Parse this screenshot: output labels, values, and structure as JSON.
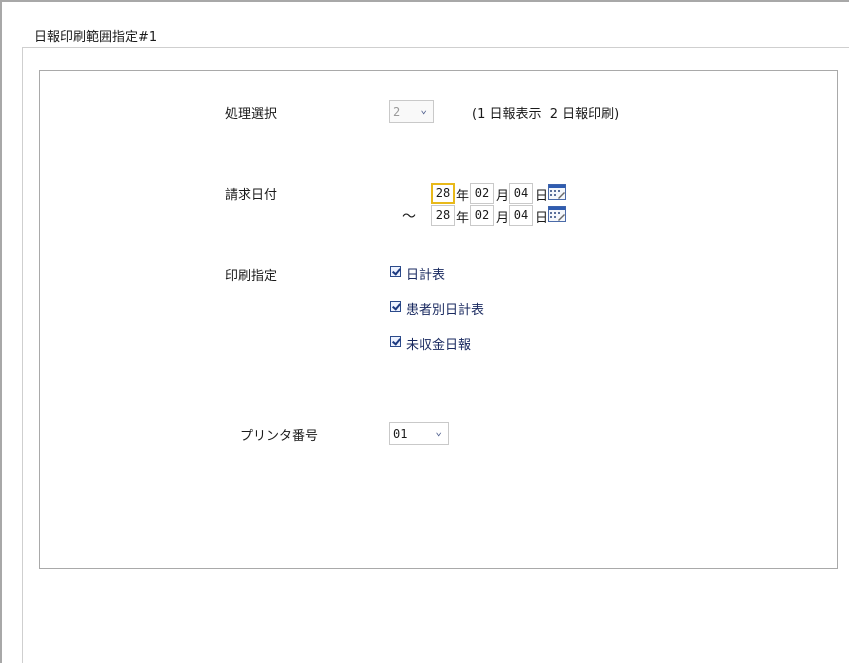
{
  "window": {
    "title": "日報印刷範囲指定#1"
  },
  "form": {
    "process_select": {
      "label": "処理選択",
      "value": "2",
      "hint": "(1 日報表示  2 日報印刷)"
    },
    "billing_date": {
      "label": "請求日付",
      "separator": "〜",
      "units": {
        "year": "年",
        "month": "月",
        "day": "日"
      },
      "from": {
        "year": "28",
        "month": "02",
        "day": "04"
      },
      "to": {
        "year": "28",
        "month": "02",
        "day": "04"
      }
    },
    "print_options": {
      "label": "印刷指定",
      "items": [
        {
          "label": "日計表",
          "checked": true
        },
        {
          "label": "患者別日計表",
          "checked": true
        },
        {
          "label": "未収金日報",
          "checked": true
        }
      ]
    },
    "printer": {
      "label": "プリンタ番号",
      "value": "01"
    }
  },
  "icons": {
    "dropdown": "chevron-down-icon",
    "calendar": "calendar-icon",
    "checkbox": "checkbox-checked-icon"
  },
  "colors": {
    "focus_border": "#e8b91a",
    "check_text": "#1a2a60"
  }
}
